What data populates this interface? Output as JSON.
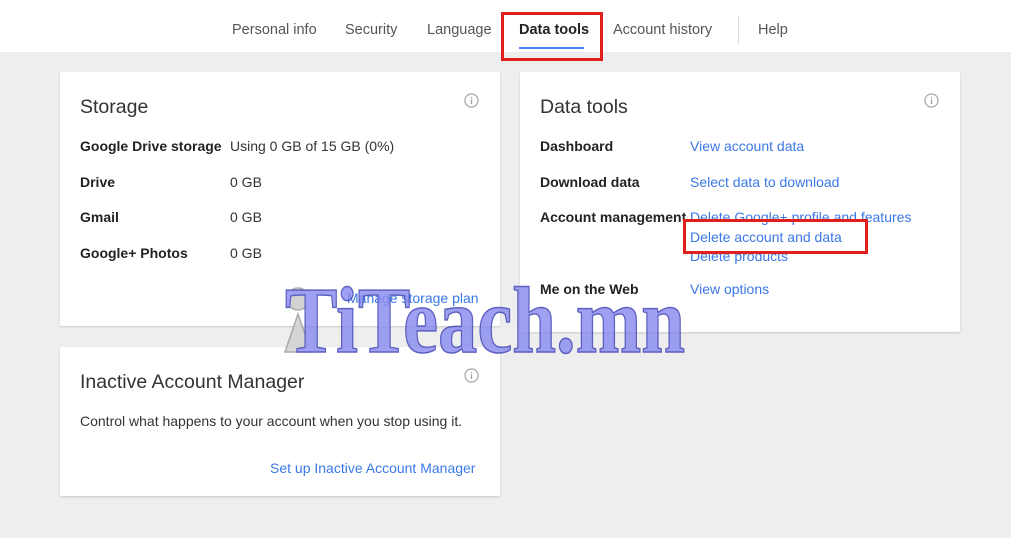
{
  "nav": {
    "tabs": [
      {
        "label": "Personal info"
      },
      {
        "label": "Security"
      },
      {
        "label": "Language"
      },
      {
        "label": "Data tools"
      },
      {
        "label": "Account history"
      },
      {
        "label": "Help"
      }
    ],
    "active_tab": "Data tools"
  },
  "storage": {
    "title": "Storage",
    "rows": [
      {
        "label": "Google Drive storage",
        "value": "Using 0 GB of 15 GB (0%)"
      },
      {
        "label": "Drive",
        "value": "0 GB"
      },
      {
        "label": "Gmail",
        "value": "0 GB"
      },
      {
        "label": "Google+ Photos",
        "value": "0 GB"
      }
    ],
    "manage_link": "Manage storage plan"
  },
  "data_tools": {
    "title": "Data tools",
    "dashboard": {
      "label": "Dashboard",
      "link": "View account data"
    },
    "download": {
      "label": "Download data",
      "link": "Select data to download"
    },
    "account_management": {
      "label": "Account management",
      "links": [
        "Delete Google+ profile and features",
        "Delete account and data",
        "Delete products"
      ]
    },
    "web": {
      "label": "Me on the Web",
      "link": "View options"
    }
  },
  "inactive": {
    "title": "Inactive Account Manager",
    "description": "Control what happens to your account when you stop using it.",
    "link": "Set up Inactive Account Manager"
  },
  "watermark": {
    "text": "TiTeach.mn"
  },
  "colors": {
    "link": "#3b78e7",
    "highlight": "#e0201f",
    "tab_underline": "#4285f4",
    "background": "#eeeeee"
  }
}
